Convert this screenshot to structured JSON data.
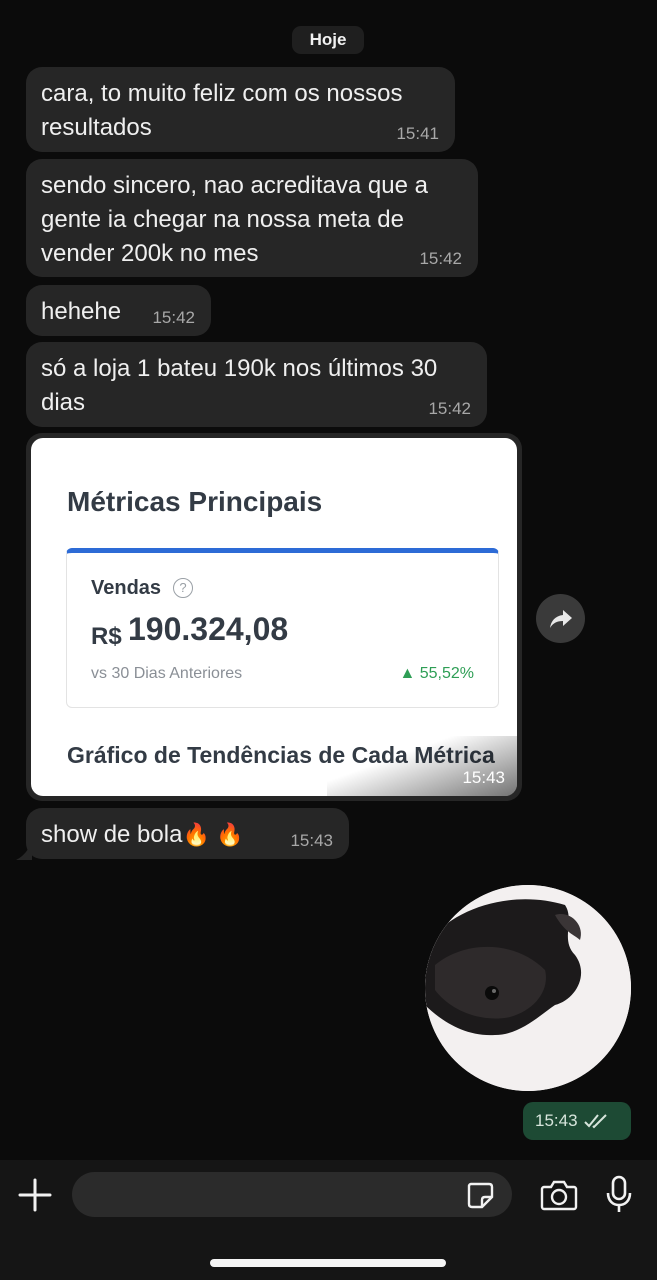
{
  "date_separator": "Hoje",
  "messages": [
    {
      "text": "cara, to muito feliz com os nossos resultados",
      "time": "15:41"
    },
    {
      "text": "sendo sincero, nao acreditava que a gente ia chegar na nossa meta de vender 200k no mes",
      "time": "15:42"
    },
    {
      "text": "hehehe",
      "time": "15:42"
    },
    {
      "text": "só a loja 1 bateu 190k nos últimos 30 dias",
      "time": "15:42"
    },
    {
      "text": "show de bola",
      "emoji": "🔥 🔥",
      "time": "15:43"
    }
  ],
  "image_message": {
    "title": "Métricas Principais",
    "metric_label": "Vendas",
    "help_symbol": "?",
    "currency": "R$",
    "value": "190.324,08",
    "comparison": "vs 30 Dias Anteriores",
    "change": "▲ 55,52%",
    "subtitle": "Gráfico de Tendências de Cada Métrica",
    "time": "15:43"
  },
  "outgoing_video_note": {
    "time": "15:43",
    "status_icon": "double-check-icon"
  },
  "colors": {
    "background": "#0b0b0b",
    "incoming_bubble": "#262626",
    "outgoing_bubble": "#1d4a34",
    "accent_blue": "#2d6bd6",
    "positive_green": "#2e9e55"
  },
  "composer": {
    "input_value": ""
  }
}
